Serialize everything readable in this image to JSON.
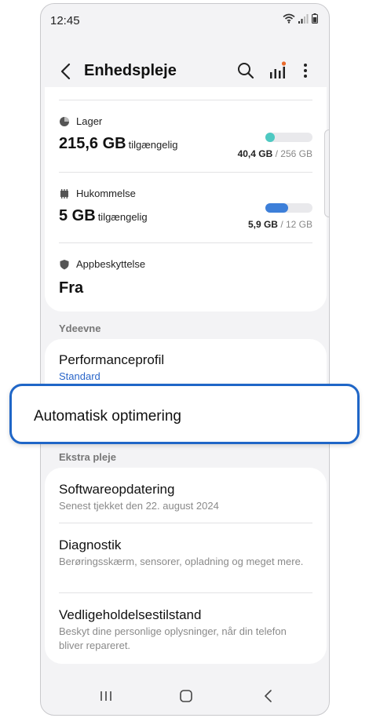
{
  "status_bar": {
    "time": "12:45"
  },
  "header": {
    "title": "Enhedspleje"
  },
  "storage": {
    "label": "Lager",
    "value": "215,6 GB",
    "suffix": "tilgængelig",
    "used": "40,4 GB",
    "total": "/ 256 GB",
    "fill_fraction": 0.16,
    "color": "#4ec9c2"
  },
  "memory": {
    "label": "Hukommelse",
    "value": "5 GB",
    "suffix": "tilgængelig",
    "used": "5,9 GB",
    "total": "/ 12 GB",
    "fill_fraction": 0.49,
    "color": "#3d7fd9"
  },
  "app_protection": {
    "label": "Appbeskyttelse",
    "value": "Fra"
  },
  "performance": {
    "section": "Ydeevne",
    "profile_title": "Performanceprofil",
    "profile_value": "Standard"
  },
  "highlight": {
    "label": "Automatisk optimering"
  },
  "extra_care": {
    "section": "Ekstra pleje",
    "items": [
      {
        "title": "Softwareopdatering",
        "subtitle": "Senest tjekket den 22. august 2024"
      },
      {
        "title": "Diagnostik",
        "subtitle": "Berøringsskærm, sensorer, opladning og meget mere."
      },
      {
        "title": "Vedligeholdelsestilstand",
        "subtitle": "Beskyt dine personlige oplysninger, når din telefon bliver repareret."
      }
    ]
  },
  "colors": {
    "accent": "#1f66c7",
    "notification_dot": "#e8692b"
  }
}
